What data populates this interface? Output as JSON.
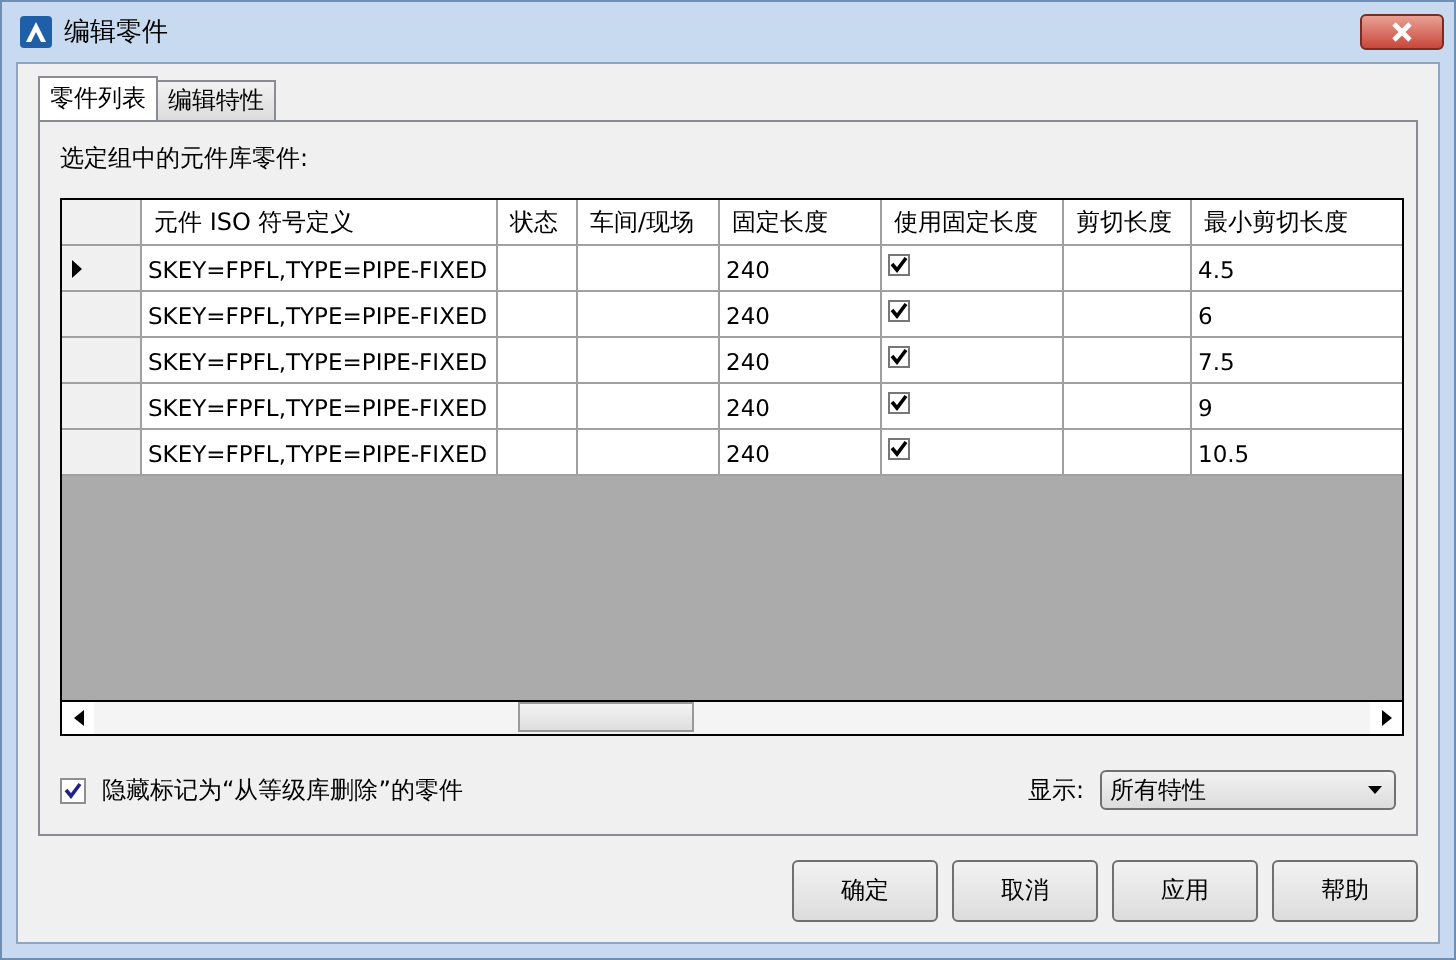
{
  "window": {
    "title": "编辑零件"
  },
  "tabs": [
    {
      "label": "零件列表",
      "selected": true
    },
    {
      "label": "编辑特性",
      "selected": false
    }
  ],
  "grid_label": "选定组中的元件库零件:",
  "table": {
    "columns": [
      "元件 ISO 符号定义",
      "状态",
      "车间/现场",
      "固定长度",
      "使用固定长度",
      "剪切长度",
      "最小剪切长度"
    ],
    "rows": [
      {
        "selected": true,
        "iso": "SKEY=FPFL,TYPE=PIPE-FIXED",
        "fixed_length": "240",
        "use_fixed_length": true,
        "min_cut_length": "4.5"
      },
      {
        "selected": false,
        "iso": "SKEY=FPFL,TYPE=PIPE-FIXED",
        "fixed_length": "240",
        "use_fixed_length": true,
        "min_cut_length": "6"
      },
      {
        "selected": false,
        "iso": "SKEY=FPFL,TYPE=PIPE-FIXED",
        "fixed_length": "240",
        "use_fixed_length": true,
        "min_cut_length": "7.5"
      },
      {
        "selected": false,
        "iso": "SKEY=FPFL,TYPE=PIPE-FIXED",
        "fixed_length": "240",
        "use_fixed_length": true,
        "min_cut_length": "9"
      },
      {
        "selected": false,
        "iso": "SKEY=FPFL,TYPE=PIPE-FIXED",
        "fixed_length": "240",
        "use_fixed_length": true,
        "min_cut_length": "10.5"
      }
    ]
  },
  "hide_deleted": {
    "label": "隐藏标记为“从等级库删除”的零件",
    "checked": true
  },
  "display": {
    "label": "显示:",
    "value": "所有特性"
  },
  "buttons": [
    "确定",
    "取消",
    "应用",
    "帮助"
  ]
}
